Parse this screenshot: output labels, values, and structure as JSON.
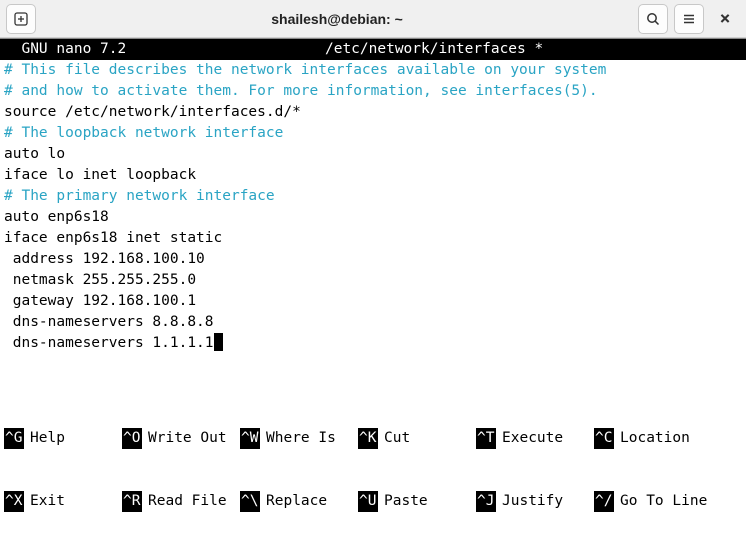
{
  "window": {
    "title": "shailesh@debian: ~"
  },
  "nano": {
    "app": "  GNU nano 7.2",
    "file": "/etc/network/interfaces *",
    "right": ""
  },
  "lines": [
    {
      "t": "# This file describes the network interfaces available on your system",
      "c": true
    },
    {
      "t": "# and how to activate them. For more information, see interfaces(5).",
      "c": true
    },
    {
      "t": "",
      "c": false
    },
    {
      "t": "source /etc/network/interfaces.d/*",
      "c": false
    },
    {
      "t": "",
      "c": false
    },
    {
      "t": "# The loopback network interface",
      "c": true
    },
    {
      "t": "auto lo",
      "c": false
    },
    {
      "t": "iface lo inet loopback",
      "c": false
    },
    {
      "t": "",
      "c": false
    },
    {
      "t": "# The primary network interface",
      "c": true
    },
    {
      "t": "auto enp6s18",
      "c": false
    },
    {
      "t": "iface enp6s18 inet static",
      "c": false
    },
    {
      "t": " address 192.168.100.10",
      "c": false
    },
    {
      "t": " netmask 255.255.255.0",
      "c": false
    },
    {
      "t": " gateway 192.168.100.1",
      "c": false
    },
    {
      "t": " dns-nameservers 8.8.8.8",
      "c": false
    },
    {
      "t": " dns-nameservers 1.1.1.1",
      "c": false,
      "cursor": true
    }
  ],
  "shortcuts": {
    "row1": [
      {
        "k": "^G",
        "l": "Help"
      },
      {
        "k": "^O",
        "l": "Write Out"
      },
      {
        "k": "^W",
        "l": "Where Is"
      },
      {
        "k": "^K",
        "l": "Cut"
      },
      {
        "k": "^T",
        "l": "Execute"
      },
      {
        "k": "^C",
        "l": "Location"
      }
    ],
    "row2": [
      {
        "k": "^X",
        "l": "Exit"
      },
      {
        "k": "^R",
        "l": "Read File"
      },
      {
        "k": "^\\",
        "l": "Replace"
      },
      {
        "k": "^U",
        "l": "Paste"
      },
      {
        "k": "^J",
        "l": "Justify"
      },
      {
        "k": "^/",
        "l": "Go To Line"
      }
    ]
  }
}
